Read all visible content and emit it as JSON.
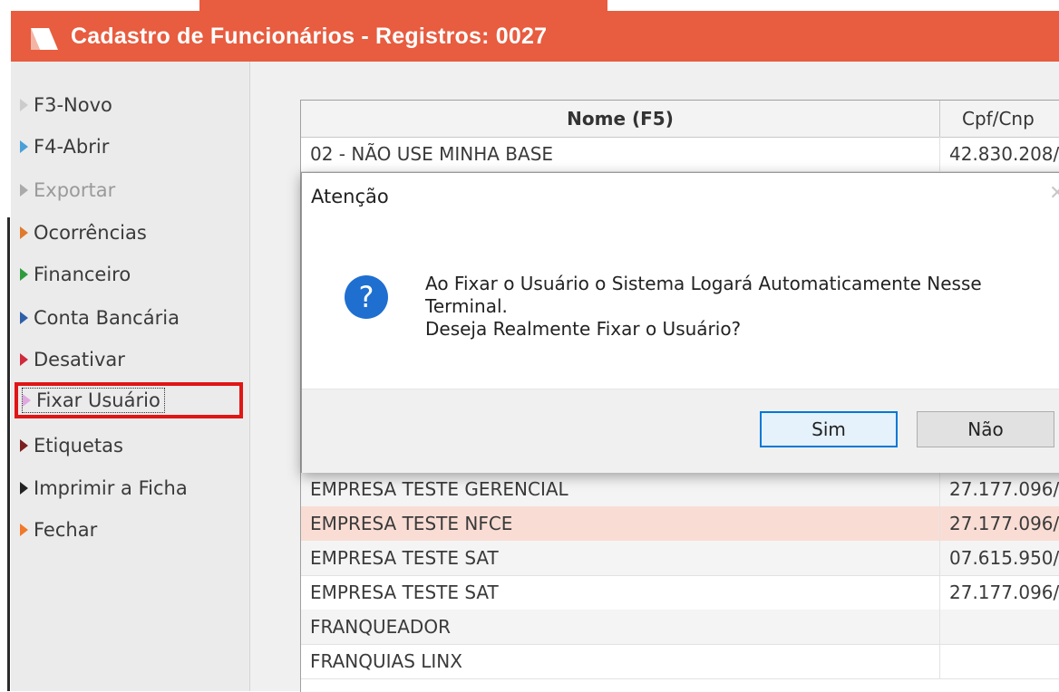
{
  "window": {
    "title": "Cadastro de Funcionários - Registros: 0027",
    "accent": "#e85c3f"
  },
  "sidebar": {
    "items": [
      {
        "label": "F3-Novo",
        "icon": "arrow-right-icon",
        "color": "#cccccc"
      },
      {
        "label": "F4-Abrir",
        "icon": "arrow-right-icon",
        "color": "#4a9fd8"
      },
      {
        "label": "Exportar",
        "icon": "arrow-right-icon",
        "color": "#aaaaaa",
        "disabled": true
      },
      {
        "label": "Ocorrências",
        "icon": "arrow-right-icon",
        "color": "#e07a2e"
      },
      {
        "label": "Financeiro",
        "icon": "arrow-right-icon",
        "color": "#2e9b3f"
      },
      {
        "label": "Conta Bancária",
        "icon": "arrow-right-icon",
        "color": "#2f5fa8"
      },
      {
        "label": "Desativar",
        "icon": "arrow-right-icon",
        "color": "#d02a3c"
      },
      {
        "label": "Fixar Usuário",
        "icon": "arrow-right-icon",
        "color": "#e0a8e0",
        "selected": true
      },
      {
        "label": "Etiquetas",
        "icon": "arrow-right-icon",
        "color": "#7a2020"
      },
      {
        "label": "Imprimir a Ficha",
        "icon": "arrow-right-icon",
        "color": "#222222"
      },
      {
        "label": "Fechar",
        "icon": "arrow-right-icon",
        "color": "#f07a2a"
      }
    ]
  },
  "grid": {
    "columns": [
      "Nome (F5)",
      "Cpf/Cnp"
    ],
    "rows": [
      {
        "name": "02 - NÃO USE MINHA BASE",
        "cpf": "42.830.208/"
      },
      {
        "name": "EMPRESA TESTE GERENCIAL",
        "cpf": "27.177.096/"
      },
      {
        "name": "EMPRESA TESTE NFCE",
        "cpf": "27.177.096/"
      },
      {
        "name": "EMPRESA TESTE SAT",
        "cpf": "07.615.950/"
      },
      {
        "name": "EMPRESA TESTE SAT",
        "cpf": "27.177.096/"
      },
      {
        "name": "FRANQUEADOR",
        "cpf": ""
      },
      {
        "name": "FRANQUIAS LINX",
        "cpf": ""
      }
    ]
  },
  "dialog": {
    "title": "Atenção",
    "icon": "question-icon",
    "message_line1": "Ao Fixar o Usuário o Sistema Logará Automaticamente Nesse",
    "message_line2": "Terminal.",
    "message_line3": "Deseja Realmente Fixar o Usuário?",
    "yes_label": "Sim",
    "no_label": "Não"
  }
}
